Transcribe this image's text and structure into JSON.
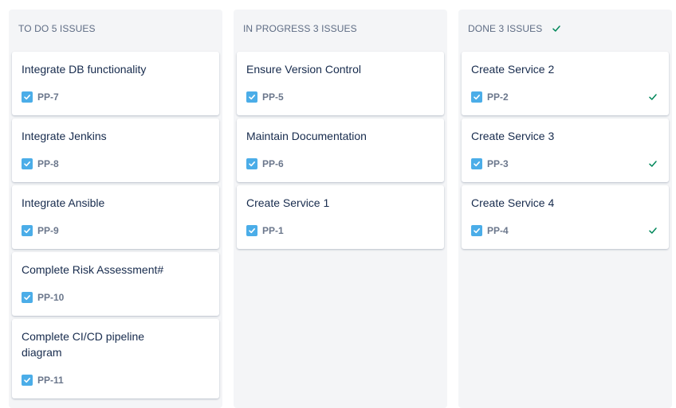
{
  "columns": {
    "todo": {
      "name": "TO DO",
      "count": "5 ISSUES",
      "cards": [
        {
          "title": "Integrate DB functionality",
          "key": "PP-7"
        },
        {
          "title": "Integrate Jenkins",
          "key": "PP-8"
        },
        {
          "title": "Integrate Ansible",
          "key": "PP-9"
        },
        {
          "title": "Complete Risk Assessment#",
          "key": "PP-10"
        },
        {
          "title": "Complete CI/CD pipeline diagram",
          "key": "PP-11"
        }
      ]
    },
    "in_progress": {
      "name": "IN PROGRESS",
      "count": "3 ISSUES",
      "cards": [
        {
          "title": "Ensure Version Control",
          "key": "PP-5"
        },
        {
          "title": "Maintain Documentation",
          "key": "PP-6"
        },
        {
          "title": "Create Service 1",
          "key": "PP-1"
        }
      ]
    },
    "done": {
      "name": "DONE",
      "count": "3 ISSUES",
      "header_icon": "check-icon",
      "cards": [
        {
          "title": "Create Service 2",
          "key": "PP-2",
          "status_icon": "check-icon"
        },
        {
          "title": "Create Service 3",
          "key": "PP-3",
          "status_icon": "check-icon"
        },
        {
          "title": "Create Service 4",
          "key": "PP-4",
          "status_icon": "check-icon"
        }
      ]
    }
  },
  "icons": {
    "issue_type": "task-checkbox-icon"
  },
  "colors": {
    "column_bg": "#f4f5f7",
    "card_bg": "#ffffff",
    "task_icon": "#4bade8",
    "done_check": "#00875a",
    "title_text": "#172b4d",
    "key_text": "#6b778c",
    "header_text": "#5e6c84"
  }
}
